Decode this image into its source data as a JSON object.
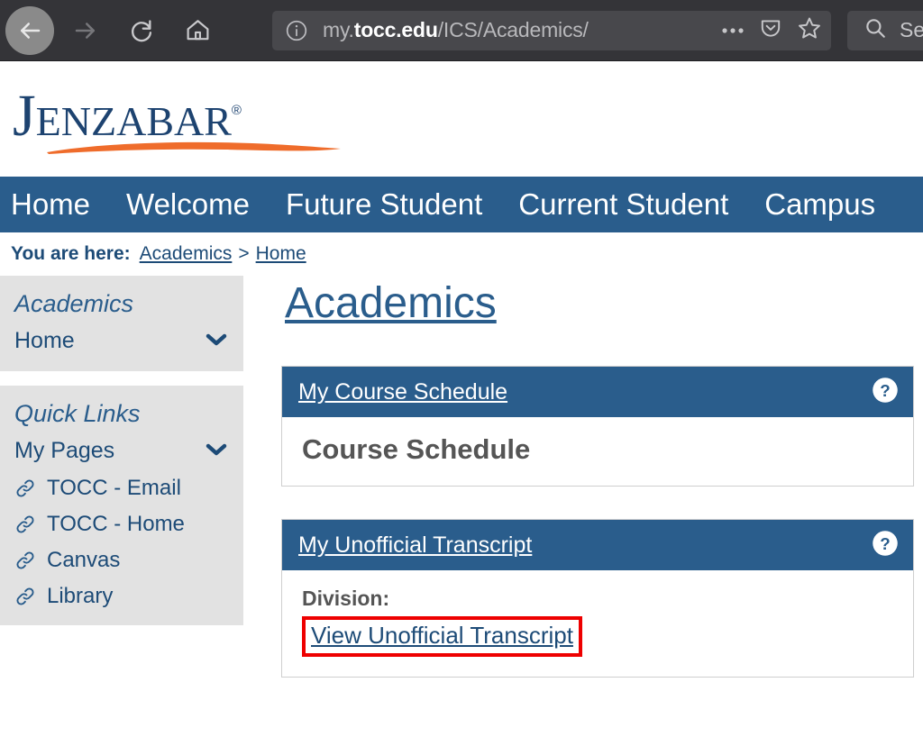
{
  "browser": {
    "back_icon": "back-arrow-icon",
    "forward_icon": "forward-arrow-icon",
    "reload_icon": "reload-icon",
    "home_icon": "home-icon",
    "url_prefix": "my.",
    "url_host": "tocc.edu",
    "url_path": "/ICS/Academics/",
    "url_full": "my.tocc.edu/ICS/Academics/",
    "info_icon": "page-info-icon",
    "more_icon": "more-actions-icon",
    "pocket_icon": "pocket-icon",
    "bookmark_icon": "star-bookmark-icon",
    "search_icon": "search-icon",
    "search_placeholder": "Sea",
    "search_value": ""
  },
  "site": {
    "logo_text": "Jenzabar",
    "logo_trademark": "®"
  },
  "mainnav": {
    "items": [
      {
        "label": "Home"
      },
      {
        "label": "Welcome"
      },
      {
        "label": "Future Student"
      },
      {
        "label": "Current Student"
      },
      {
        "label": "Campus"
      }
    ]
  },
  "breadcrumb": {
    "label": "You are here:",
    "items": [
      {
        "label": "Academics"
      },
      {
        "label": "Home"
      }
    ],
    "separator": ">"
  },
  "sidebar": {
    "boxes": [
      {
        "title": "Academics",
        "rows": [
          {
            "label": "Home",
            "chevron": "chevron-down-icon"
          }
        ],
        "links": []
      },
      {
        "title": "Quick Links",
        "rows": [
          {
            "label": "My Pages",
            "chevron": "chevron-down-icon"
          }
        ],
        "links": [
          {
            "label": "TOCC - Email",
            "icon": "link-chain-icon"
          },
          {
            "label": "TOCC - Home",
            "icon": "link-chain-icon"
          },
          {
            "label": "Canvas",
            "icon": "link-chain-icon"
          },
          {
            "label": "Library",
            "icon": "link-chain-icon"
          }
        ]
      }
    ]
  },
  "main": {
    "title": "Academics",
    "portlets": [
      {
        "header": "My Course Schedule",
        "help_icon": "help-question-icon",
        "body_heading": "Course Schedule"
      },
      {
        "header": "My Unofficial Transcript",
        "help_icon": "help-question-icon",
        "body_label": "Division:",
        "body_link": "View Unofficial Transcript",
        "highlighted": true
      }
    ]
  },
  "colors": {
    "brand_blue": "#2a5d8c",
    "logo_navy": "#1d4370",
    "logo_orange": "#ef6c2b",
    "link_navy": "#1d4b77",
    "sidebar_gray": "#e2e2e2",
    "highlight_red": "#ee0000",
    "chrome_dark": "#343438"
  }
}
